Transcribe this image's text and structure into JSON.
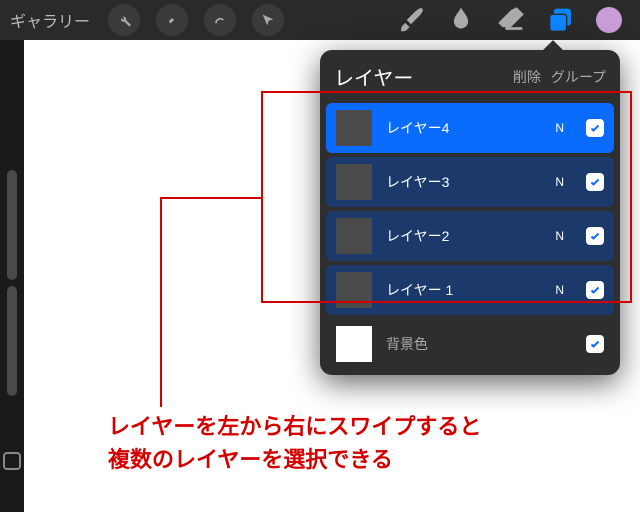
{
  "topbar": {
    "gallery_label": "ギャラリー"
  },
  "layers_panel": {
    "title": "レイヤー",
    "delete_label": "削除",
    "group_label": "グループ",
    "layers": [
      {
        "name": "レイヤー4",
        "blend": "N",
        "selected": "primary"
      },
      {
        "name": "レイヤー3",
        "blend": "N",
        "selected": "secondary"
      },
      {
        "name": "レイヤー2",
        "blend": "N",
        "selected": "secondary"
      },
      {
        "name": "レイヤー 1",
        "blend": "N",
        "selected": "secondary"
      }
    ],
    "background_label": "背景色"
  },
  "annotation": {
    "text_line1": "レイヤーを左から右にスワイプすると",
    "text_line2": "複数のレイヤーを選択できる"
  },
  "colors": {
    "accent": "#0a84ff",
    "swatch": "#c89cd6",
    "annotation": "#d40000"
  }
}
